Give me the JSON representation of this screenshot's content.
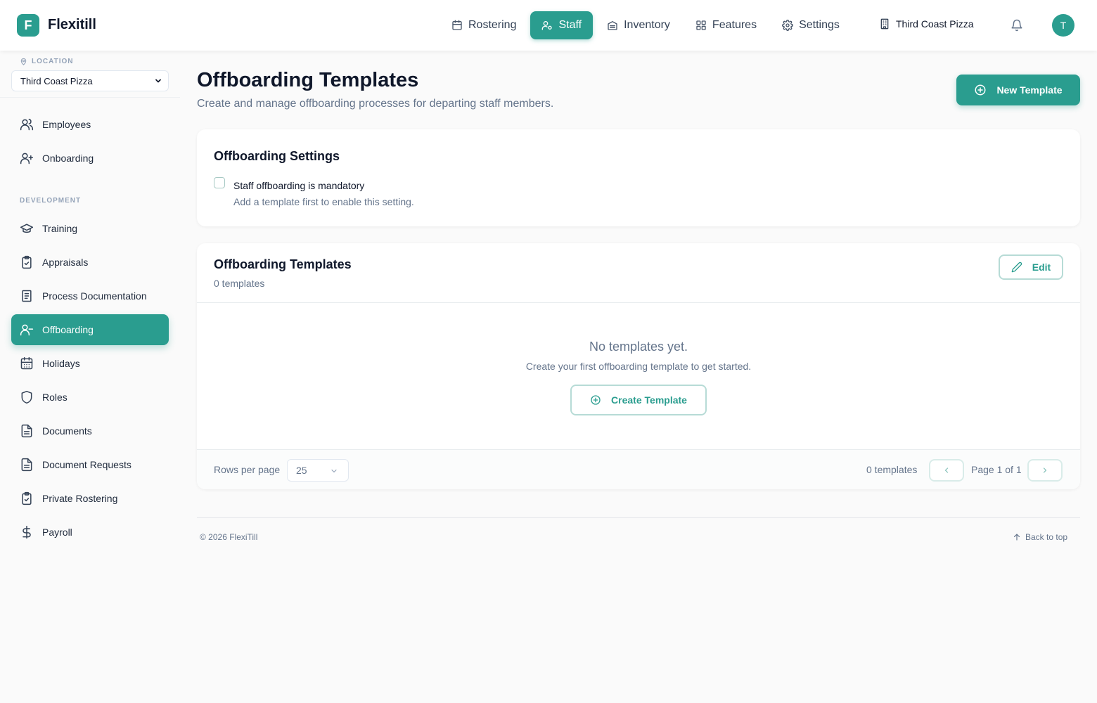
{
  "app": {
    "logo_letter": "F",
    "name": "Flexitill"
  },
  "topnav": {
    "items": [
      {
        "label": "Rostering",
        "icon": "calendar-icon",
        "active": false
      },
      {
        "label": "Staff",
        "icon": "users-icon",
        "active": true
      },
      {
        "label": "Inventory",
        "icon": "archive-icon",
        "active": false
      },
      {
        "label": "Features",
        "icon": "grid-icon",
        "active": false
      },
      {
        "label": "Settings",
        "icon": "gear-icon",
        "active": false
      }
    ],
    "location": "Third Coast Pizza",
    "avatar_initial": "T"
  },
  "sidebar": {
    "location_label": "LOCATION",
    "location_value": "Third Coast Pizza",
    "section_development": "DEVELOPMENT",
    "items": [
      {
        "label": "Employees",
        "icon": "users-icon"
      },
      {
        "label": "Onboarding",
        "icon": "user-plus-icon"
      },
      {
        "label": "Training",
        "icon": "graduation-cap-icon"
      },
      {
        "label": "Appraisals",
        "icon": "clipboard-check-icon"
      },
      {
        "label": "Process Documentation",
        "icon": "book-icon"
      },
      {
        "label": "Offboarding",
        "icon": "user-minus-icon",
        "active": true
      },
      {
        "label": "Holidays",
        "icon": "calendar-icon"
      },
      {
        "label": "Roles",
        "icon": "shield-icon"
      },
      {
        "label": "Documents",
        "icon": "file-text-icon"
      },
      {
        "label": "Document Requests",
        "icon": "file-text-icon"
      },
      {
        "label": "Private Rostering",
        "icon": "clipboard-check-icon"
      },
      {
        "label": "Payroll",
        "icon": "dollar-icon"
      }
    ]
  },
  "header": {
    "title": "Offboarding Templates",
    "subtitle": "Create and manage offboarding processes for departing staff members.",
    "new_button": "New Template"
  },
  "settings_card": {
    "title": "Offboarding Settings",
    "checkbox_label": "Staff offboarding is mandatory",
    "checkbox_hint": "Add a template first to enable this setting.",
    "checked": false
  },
  "templates_card": {
    "title": "Offboarding Templates",
    "count": "0 templates",
    "edit_button": "Edit",
    "empty_title": "No templates yet.",
    "empty_subtitle": "Create your first offboarding template to get started.",
    "create_button": "Create Template",
    "rows_per_page_label": "Rows per page",
    "rows_per_page_value": "25",
    "footer_count": "0 templates",
    "page_text": "Page 1 of 1"
  },
  "footer": {
    "copyright": "© 2026 FlexiTill",
    "back_to_top": "Back to top"
  },
  "colors": {
    "accent": "#2a9d8f",
    "background": "#fafafa",
    "text": "#0f172a",
    "muted": "#64748b"
  }
}
